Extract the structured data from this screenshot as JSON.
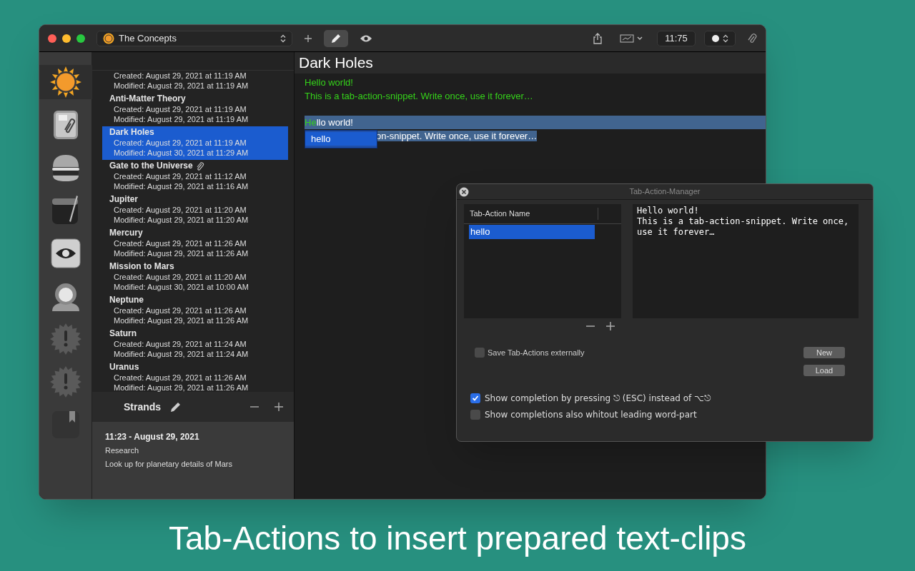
{
  "toolbar": {
    "document": "The Concepts",
    "modes": [
      {
        "kind": "edit",
        "selected": true
      },
      {
        "kind": "preview",
        "selected": false
      }
    ],
    "time": "11:75"
  },
  "dock": [
    {
      "selected": true
    },
    {
      "selected": false
    },
    {
      "selected": false
    },
    {
      "selected": false
    },
    {
      "selected": false
    },
    {
      "selected": false
    },
    {
      "selected": false
    },
    {
      "selected": false
    },
    {
      "selected": false
    }
  ],
  "notes": [
    {
      "created": "Created: August 29, 2021 at 11:19 AM",
      "modified": "Modified: August 29, 2021 at 11:19 AM",
      "selected": false
    },
    {
      "title": "Anti-Matter Theory",
      "created": "Created: August 29, 2021 at 11:19 AM",
      "modified": "Modified: August 29, 2021 at 11:19 AM",
      "selected": false
    },
    {
      "title": "Dark Holes",
      "created": "Created: August 29, 2021 at 11:19 AM",
      "modified": "Modified: August 30, 2021 at 11:29 AM",
      "selected": true
    },
    {
      "title": "Gate to the Universe",
      "attachment": true,
      "created": "Created: August 29, 2021 at 11:12 AM",
      "modified": "Modified: August 29, 2021 at 11:16 AM",
      "selected": false
    },
    {
      "title": "Jupiter",
      "created": "Created: August 29, 2021 at 11:20 AM",
      "modified": "Modified: August 29, 2021 at 11:20 AM",
      "selected": false
    },
    {
      "title": "Mercury",
      "created": "Created: August 29, 2021 at 11:26 AM",
      "modified": "Modified: August 29, 2021 at 11:26 AM",
      "selected": false
    },
    {
      "title": "Mission to Mars",
      "created": "Created: August 29, 2021 at 11:20 AM",
      "modified": "Modified: August 30, 2021 at 10:00 AM",
      "selected": false
    },
    {
      "title": "Neptune",
      "created": "Created: August 29, 2021 at 11:26 AM",
      "modified": "Modified: August 29, 2021 at 11:26 AM",
      "selected": false
    },
    {
      "title": "Saturn",
      "created": "Created: August 29, 2021 at 11:24 AM",
      "modified": "Modified: August 29, 2021 at 11:24 AM",
      "selected": false
    },
    {
      "title": "Uranus",
      "created": "Created: August 29, 2021 at 11:26 AM",
      "modified": "Modified: August 29, 2021 at 11:26 AM",
      "selected": false
    }
  ],
  "strands": {
    "title": "Strands",
    "entries": [
      {
        "time": "11:23 - August 29, 2021",
        "title": "Research",
        "description": "Look up for planetary details of Mars"
      }
    ]
  },
  "editor": {
    "title": "Dark Holes",
    "paragraphs": [
      [
        {
          "segments": [
            {
              "text": "Hello world!",
              "kind": "snippet"
            }
          ]
        },
        {
          "segments": [
            {
              "text": "This is a tab-action-snippet. Write once, use it forever…",
              "kind": "snippet"
            }
          ]
        }
      ],
      [
        {
          "selection_to_end": true,
          "segments": [
            {
              "text": "He",
              "kind": "snippet"
            },
            {
              "text": "llo world!",
              "kind": "selected"
            }
          ]
        },
        {
          "autocomplete": {
            "items": [
              {
                "label": "hello",
                "selected": true
              }
            ]
          },
          "segments": [
            {
              "text": "on-snippet. Write once, use it forever…",
              "kind": "selected"
            }
          ]
        }
      ]
    ]
  },
  "dialog": {
    "title": "Tab-Action-Manager",
    "column": "Tab-Action Name",
    "actions": [
      {
        "name": "hello",
        "selected": true
      }
    ],
    "snippet": "Hello world!\nThis is a tab-action-snippet. Write once, use it forever…",
    "save_externally": {
      "label": "Save Tab-Actions externally",
      "checked": false
    },
    "buttons": [
      "New",
      "Load"
    ],
    "options": [
      {
        "label": "Show completion by pressing ⎋ (ESC) instead of ⌥⎋",
        "checked": true
      },
      {
        "label": "Show completions also whitout leading word-part",
        "checked": false
      }
    ]
  },
  "caption": "Tab-Actions to insert prepared text-clips"
}
